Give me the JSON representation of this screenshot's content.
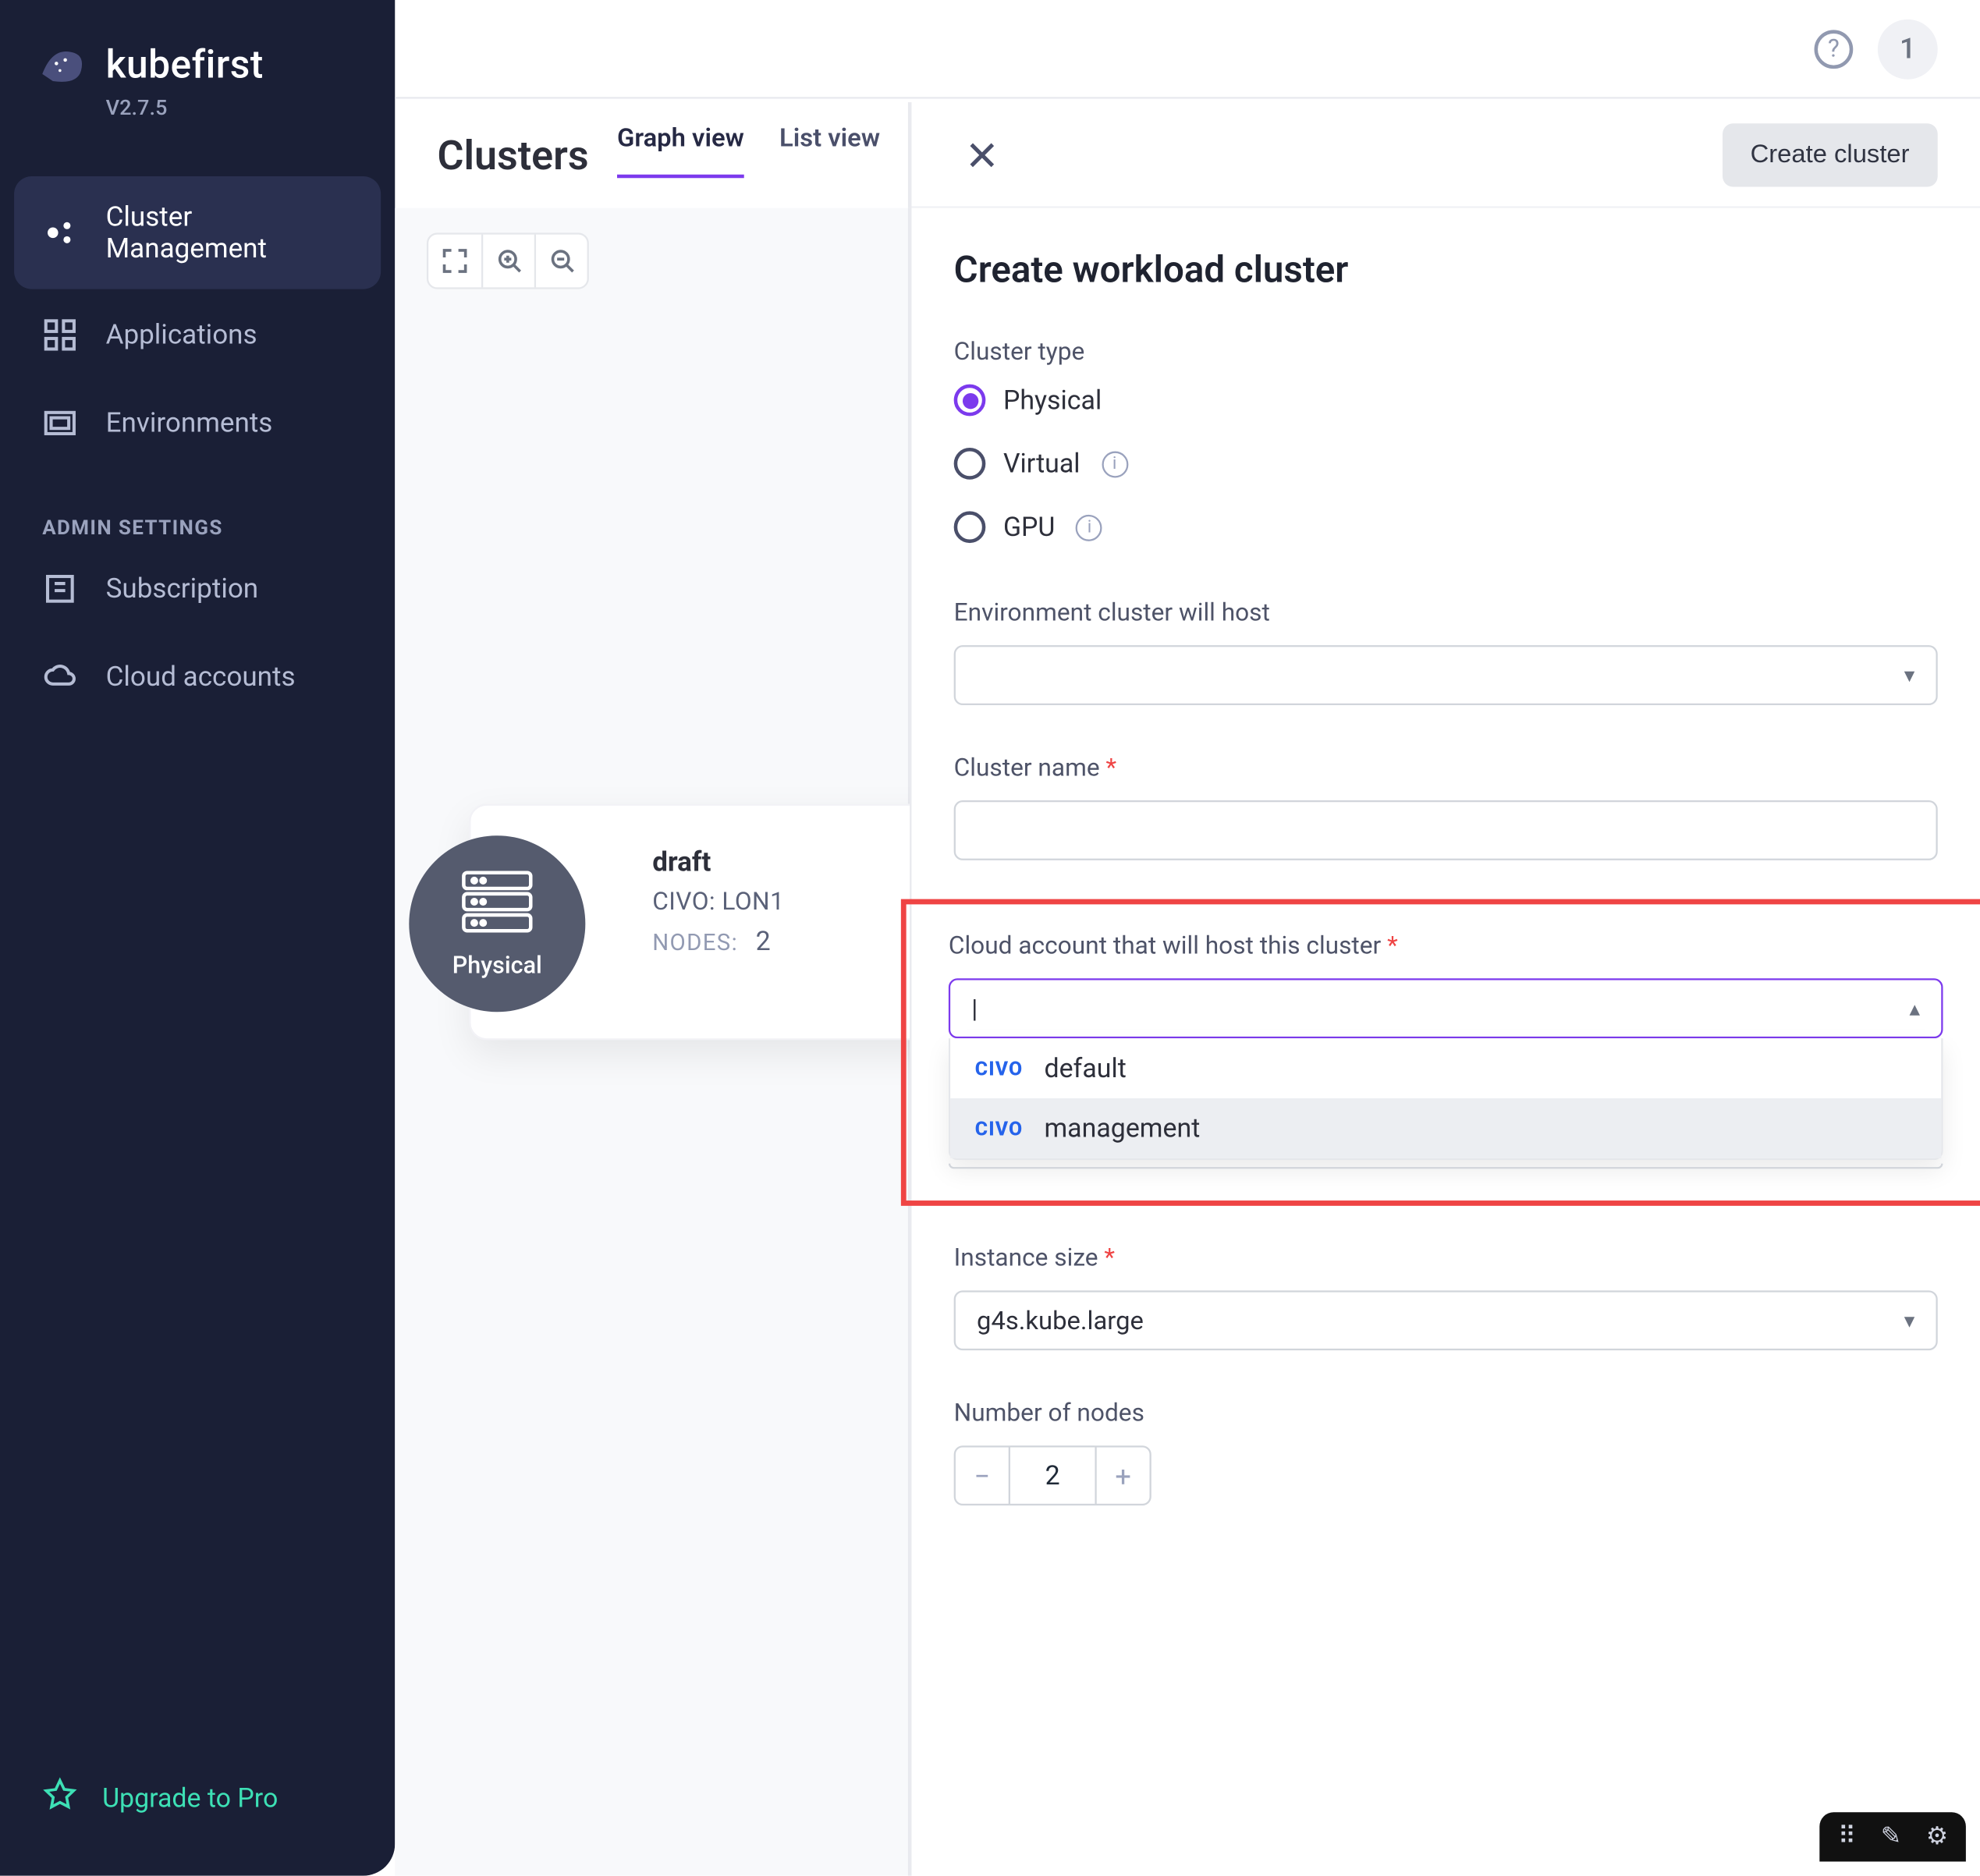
{
  "brand": {
    "name": "kubefirst",
    "version": "V2.7.5"
  },
  "nav": {
    "items": [
      {
        "label": "Cluster Management"
      },
      {
        "label": "Applications"
      },
      {
        "label": "Environments"
      }
    ],
    "admin_section": "ADMIN SETTINGS",
    "admin_items": [
      {
        "label": "Subscription"
      },
      {
        "label": "Cloud accounts"
      }
    ],
    "upgrade": "Upgrade to Pro"
  },
  "topbar": {
    "badge": "1"
  },
  "page": {
    "title": "Clusters",
    "tabs": {
      "graph": "Graph view",
      "list": "List view"
    }
  },
  "cluster_card": {
    "type_label": "Physical",
    "name": "draft",
    "provider_line": "CIVO: LON1",
    "nodes_label": "NODES:",
    "nodes_value": "2"
  },
  "panel": {
    "create_button": "Create cluster",
    "title": "Create workload cluster",
    "cluster_type_label": "Cluster type",
    "cluster_type_options": {
      "physical": "Physical",
      "virtual": "Virtual",
      "gpu": "GPU"
    },
    "env_label": "Environment cluster will host",
    "name_label": "Cluster name",
    "cloud_account_label": "Cloud account that will host this cluster",
    "cloud_provider_badge": "CIVO",
    "cloud_options": {
      "opt1": "default",
      "opt2": "management"
    },
    "instance_label": "Instance size",
    "instance_value": "g4s.kube.large",
    "nodes_label": "Number of nodes",
    "nodes_value": "2"
  }
}
